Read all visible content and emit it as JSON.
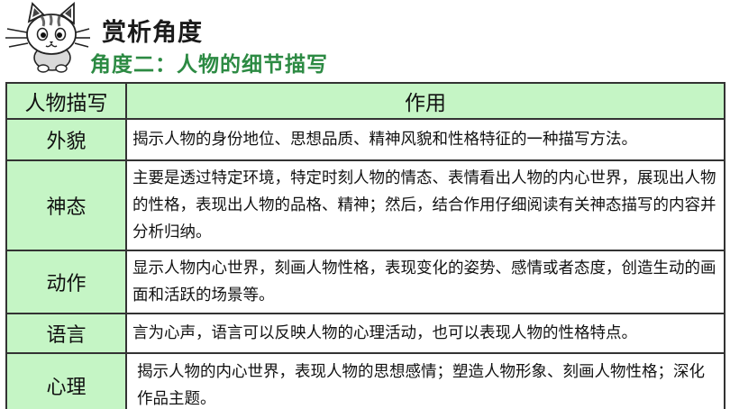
{
  "header": {
    "title": "赏析角度",
    "subtitle": "角度二：人物的细节描写",
    "logo_icon": "cat-mascot-icon"
  },
  "colors": {
    "accent_green": "#2c8a43",
    "cell_green": "#c5f5c5"
  },
  "table": {
    "headers": [
      "人物描写",
      "作用"
    ],
    "rows": [
      {
        "key": "外貌",
        "value": "揭示人物的身份地位、思想品质、精神风貌和性格特征的一种描写方法。"
      },
      {
        "key": "神态",
        "value": "主要是透过特定环境，特定时刻人物的情态、表情看出人物的内心世界，展现出人物的性格，表现出人物的品格、精神；然后，结合作用仔细阅读有关神态描写的内容并分析归纳。"
      },
      {
        "key": "动作",
        "value": "显示人物内心世界，刻画人物性格，表现变化的姿势、感情或者态度，创造生动的画面和活跃的场景等。"
      },
      {
        "key": "语言",
        "value": "言为心声，语言可以反映人物的心理活动，也可以表现人物的性格特点。"
      },
      {
        "key": "心理",
        "value": "揭示人物的内心世界，表现人物的思想感情；塑造人物形象、刻画人物性格；深化作品主题。"
      }
    ]
  }
}
